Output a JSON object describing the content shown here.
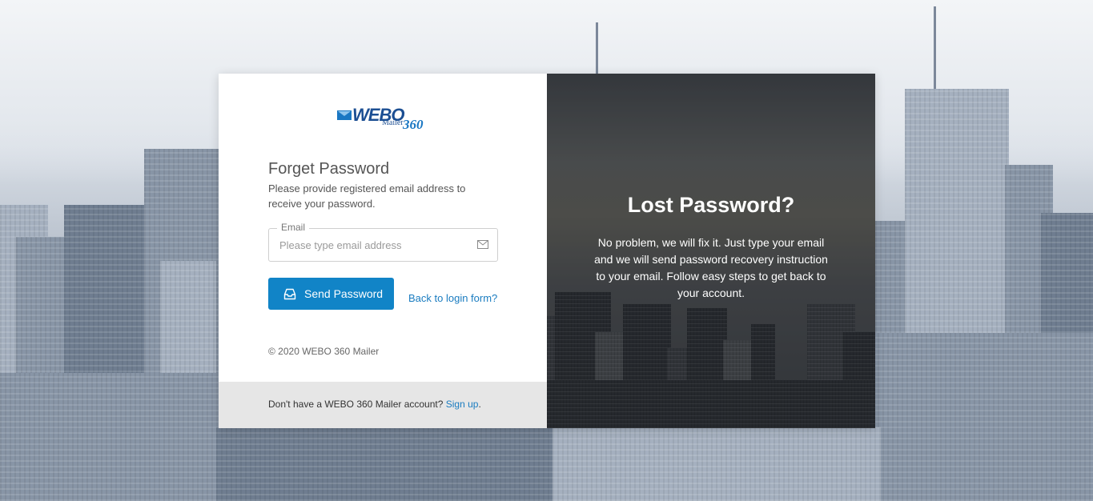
{
  "logo": {
    "text": "WEBO",
    "sub": "Mailer",
    "num": "360"
  },
  "form": {
    "title": "Forget Password",
    "description": "Please provide registered email address to receive your password.",
    "email_label": "Email",
    "email_placeholder": "Please type email address",
    "email_value": "",
    "send_label": "Send Password",
    "back_link": "Back to login form?",
    "copyright": "© 2020 WEBO 360 Mailer"
  },
  "footer": {
    "text": "Don't have a WEBO 360 Mailer account?",
    "signup_label": "Sign up",
    "period": "."
  },
  "panel": {
    "title": "Lost Password?",
    "text": "No problem, we will fix it. Just type your email and we will send password recovery instruction to your email. Follow easy steps to get back to your account."
  },
  "colors": {
    "primary": "#1184c7",
    "link": "#1a7cc0",
    "footer_bg": "#e6e6e6"
  },
  "icons": [
    "envelope-logo-icon",
    "mail-icon",
    "inbox-icon"
  ]
}
